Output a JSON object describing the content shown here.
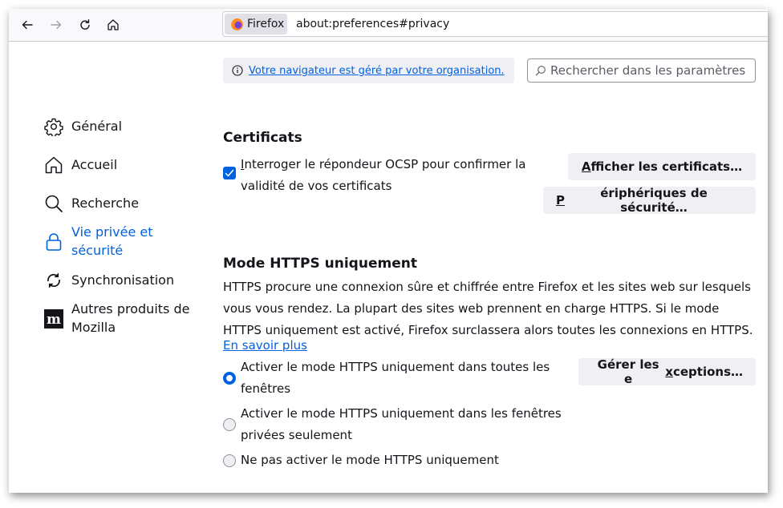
{
  "toolbar": {
    "identity_label": "Firefox",
    "url": "about:preferences#privacy"
  },
  "policy": {
    "message": "Votre navigateur est géré par votre organisation."
  },
  "search": {
    "placeholder": "Rechercher dans les paramètres"
  },
  "sidebar": {
    "items": [
      {
        "label": "Général",
        "icon": "gear-icon"
      },
      {
        "label": "Accueil",
        "icon": "home-icon"
      },
      {
        "label": "Recherche",
        "icon": "search-icon"
      },
      {
        "label": "Vie privée et sécurité",
        "icon": "lock-icon",
        "active": true
      },
      {
        "label": "Synchronisation",
        "icon": "sync-icon"
      },
      {
        "label": "Autres produits de Mozilla",
        "icon": "mozilla-icon"
      }
    ]
  },
  "certificates": {
    "title": "Certificats",
    "ocsp_label_first": "I",
    "ocsp_label_rest": "nterroger le répondeur OCSP pour confirmer la validité de vos certificats",
    "ocsp_checked": true,
    "view_button_first": "A",
    "view_button_rest": "fficher les certificats…",
    "devices_button_first": "P",
    "devices_button_rest": "ériphériques de sécurité…"
  },
  "https": {
    "title": "Mode HTTPS uniquement",
    "description": "HTTPS procure une connexion sûre et chiffrée entre Firefox et les sites web sur lesquels vous vous rendez. La plupart des sites web prennent en charge HTTPS. Si le mode HTTPS uniquement est activé, Firefox surclassera alors toutes les connexions en HTTPS.",
    "learn_more": "En savoir plus",
    "exceptions_button_pre": "Gérer les e",
    "exceptions_button_u": "x",
    "exceptions_button_post": "ceptions…",
    "options": [
      {
        "label": "Activer le mode HTTPS uniquement dans toutes les fenêtres",
        "checked": true
      },
      {
        "label": "Activer le mode HTTPS uniquement dans les fenêtres privées seulement",
        "checked": false
      },
      {
        "label": "Ne pas activer le mode HTTPS uniquement",
        "checked": false
      }
    ]
  }
}
